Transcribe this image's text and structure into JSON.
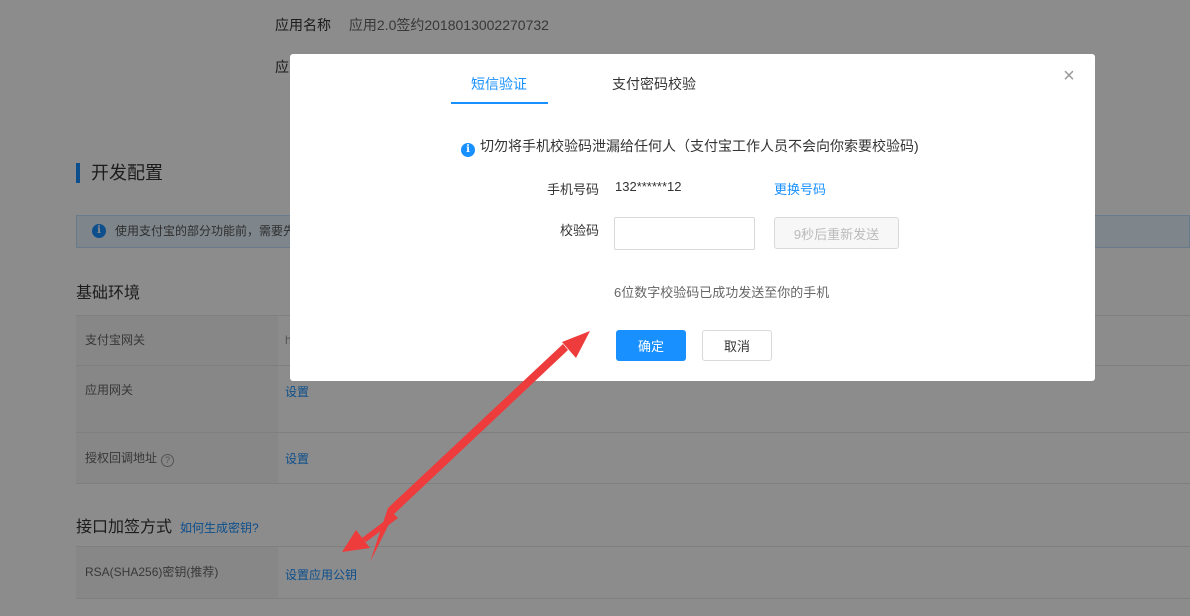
{
  "app_info": {
    "name_label": "应用名称",
    "name_value": "应用2.0签约2018013002270732",
    "second_label": "应"
  },
  "dev_config": {
    "title": "开发配置",
    "tip": "使用支付宝的部分功能前，需要先"
  },
  "base_env": {
    "title": "基础环境",
    "rows": [
      {
        "key": "支付宝网关",
        "value": "h"
      },
      {
        "key": "应用网关",
        "value": "设置"
      },
      {
        "key": "授权回调地址",
        "value": "设置"
      }
    ]
  },
  "sign_method": {
    "title": "接口加签方式",
    "help_link": "如何生成密钥?",
    "rows": [
      {
        "key": "RSA(SHA256)密钥(推荐)",
        "value": "设置应用公钥"
      }
    ]
  },
  "modal": {
    "tabs": [
      "短信验证",
      "支付密码校验"
    ],
    "active_tab": 0,
    "warning": "切勿将手机校验码泄漏给任何人（支付宝工作人员不会向你索要校验码)",
    "phone_label": "手机号码",
    "phone_value": "132******12",
    "change_phone": "更换号码",
    "code_label": "校验码",
    "code_value": "",
    "resend_label": "9秒后重新发送",
    "hint": "6位数字校验码已成功发送至你的手机",
    "ok_label": "确定",
    "cancel_label": "取消",
    "close_icon": "close-icon"
  },
  "colors": {
    "accent": "#1890ff",
    "annotation_arrow": "#ee3b3b"
  }
}
